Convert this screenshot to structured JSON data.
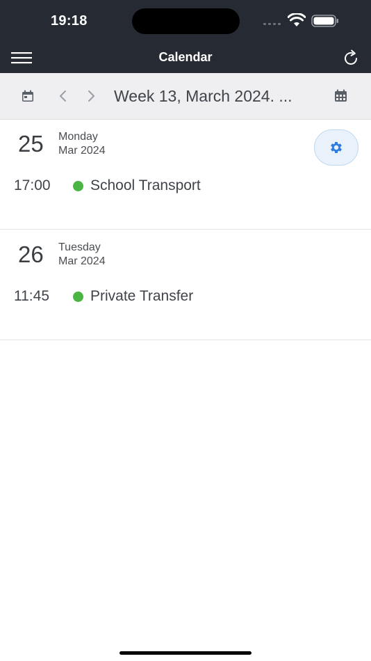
{
  "status_bar": {
    "time": "19:18"
  },
  "nav": {
    "title": "Calendar",
    "menu_icon": "hamburger-menu-icon",
    "refresh_icon": "refresh-icon"
  },
  "week_bar": {
    "label": "Week 13, March 2024. ...",
    "left_icon": "calendar-icon",
    "prev_icon": "chevron-left-icon",
    "next_icon": "chevron-right-icon",
    "right_icon": "calendar-grid-icon"
  },
  "days": [
    {
      "number": "25",
      "weekday": "Monday",
      "month": "Mar 2024",
      "events": [
        {
          "time": "17:00",
          "title": "School Transport",
          "color": "#4bb543"
        }
      ]
    },
    {
      "number": "26",
      "weekday": "Tuesday",
      "month": "Mar 2024",
      "events": [
        {
          "time": "11:45",
          "title": "Private Transfer",
          "color": "#4bb543"
        }
      ]
    }
  ],
  "colors": {
    "topbar": "#262b33",
    "accent": "#2f7de1",
    "event_dot": "#4bb543"
  }
}
